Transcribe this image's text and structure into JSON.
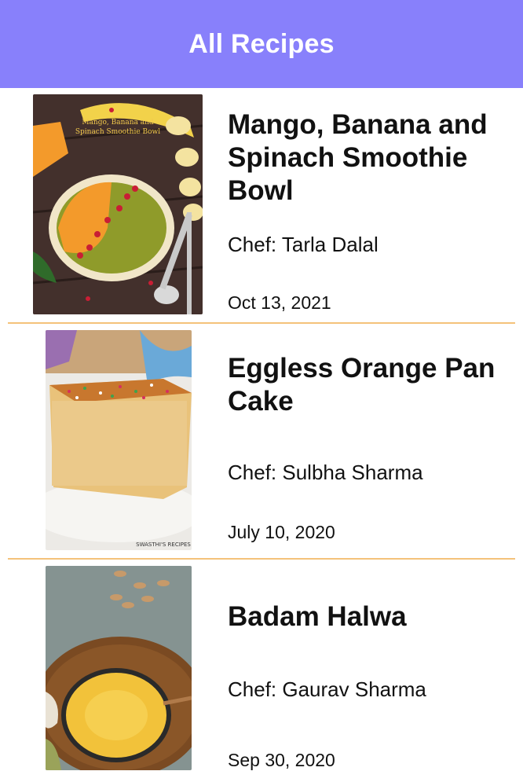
{
  "header": {
    "title": "All Recipes"
  },
  "recipes": [
    {
      "title": "Mango, Banana and Spinach Smoothie Bowl",
      "chef": "Chef: Tarla Dalal",
      "date": "Oct 13, 2021",
      "image_caption": "Mango, Banana and Spinach Smoothie Bowl"
    },
    {
      "title": "Eggless Orange Pan Cake",
      "chef": "Chef: Sulbha Sharma",
      "date": "July 10, 2020",
      "image_caption": "SWASTHI'S RECIPES"
    },
    {
      "title": "Badam Halwa",
      "chef": "Chef: Gaurav Sharma",
      "date": "Sep 30, 2020"
    }
  ],
  "colors": {
    "header_bg": "#8880fb",
    "divider": "#f4c27a"
  }
}
